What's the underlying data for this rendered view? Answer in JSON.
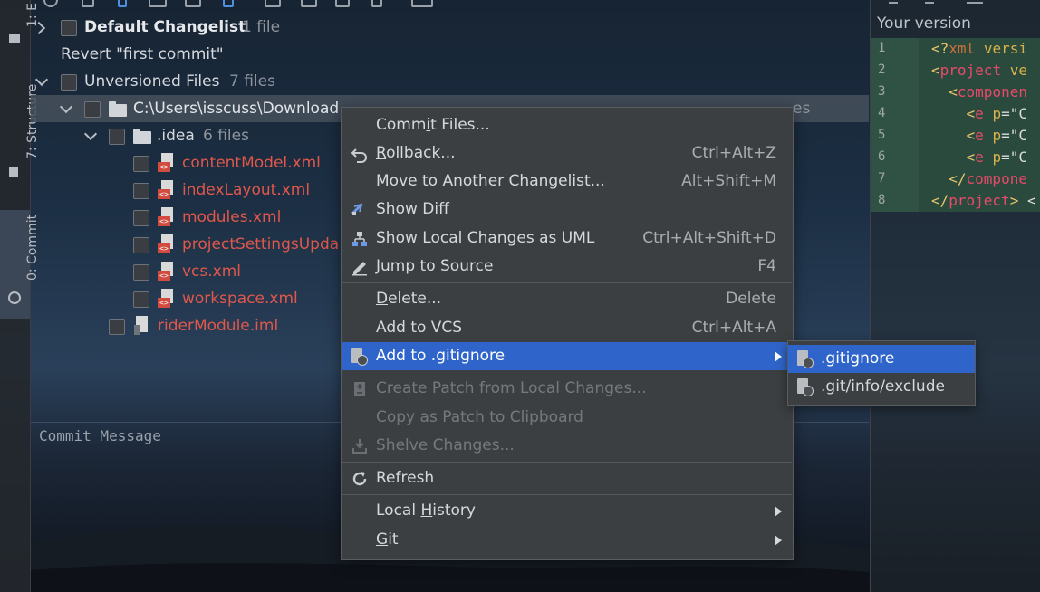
{
  "left_strip": {
    "tabs": [
      {
        "label": "1: E"
      },
      {
        "label": "7: Structure"
      },
      {
        "label": "0: Commit"
      }
    ]
  },
  "changes_tree": {
    "default_changelist": {
      "name": "Default Changelist",
      "count": "1 file"
    },
    "revert_item": "Revert \"first commit\"",
    "unversioned": {
      "name": "Unversioned Files",
      "count": "7 files"
    },
    "root_path": {
      "label": "C:\\Users\\isscuss\\Download",
      "count_tail": "es"
    },
    "idea_folder": {
      "name": ".idea",
      "count": "6 files"
    },
    "files": [
      "contentModel.xml",
      "indexLayout.xml",
      "modules.xml",
      "projectSettingsUpda",
      "vcs.xml",
      "workspace.xml"
    ],
    "module_file": "riderModule.iml"
  },
  "commit_message": {
    "placeholder": "Commit Message"
  },
  "diff_pane": {
    "title": "Your version",
    "line_numbers": [
      "1",
      "2",
      "3",
      "4",
      "5",
      "6",
      "7",
      "8"
    ]
  },
  "context_menu": {
    "items": [
      {
        "pre": "Comm",
        "u": "i",
        "post": "t Files...",
        "shortcut": ""
      },
      {
        "pre": "",
        "u": "R",
        "post": "ollback...",
        "shortcut": "Ctrl+Alt+Z"
      },
      {
        "pre": "Move to Another Changelist...",
        "u": "",
        "post": "",
        "shortcut": "Alt+Shift+M"
      },
      {
        "pre": "Show Diff",
        "u": "",
        "post": "",
        "shortcut": ""
      },
      {
        "pre": "Show Local Changes as UML",
        "u": "",
        "post": "",
        "shortcut": "Ctrl+Alt+Shift+D"
      },
      {
        "pre": "Jump to Source",
        "u": "",
        "post": "",
        "shortcut": "F4"
      },
      {
        "pre": "",
        "u": "D",
        "post": "elete...",
        "shortcut": "Delete"
      },
      {
        "pre": "Add to VCS",
        "u": "",
        "post": "",
        "shortcut": "Ctrl+Alt+A"
      },
      {
        "pre": "Add to .gitignore",
        "u": "",
        "post": "",
        "shortcut": ""
      },
      {
        "pre": "Create Patch from Local Changes...",
        "u": "",
        "post": "",
        "shortcut": ""
      },
      {
        "pre": "Copy as Patch to Clipboard",
        "u": "",
        "post": "",
        "shortcut": ""
      },
      {
        "pre": "Shelve Changes...",
        "u": "",
        "post": "",
        "shortcut": ""
      },
      {
        "pre": "Refresh",
        "u": "",
        "post": "",
        "shortcut": ""
      },
      {
        "pre": "Local ",
        "u": "H",
        "post": "istory",
        "shortcut": ""
      },
      {
        "pre": "",
        "u": "G",
        "post": "it",
        "shortcut": ""
      }
    ]
  },
  "submenu": {
    "items": [
      ".gitignore",
      ".git/info/exclude"
    ]
  },
  "colors": {
    "selection": "#2f65ca",
    "unversioned_file": "#e0574b",
    "menu_bg": "#3c3f41",
    "diff_added_bg": "#2a4a3e"
  }
}
